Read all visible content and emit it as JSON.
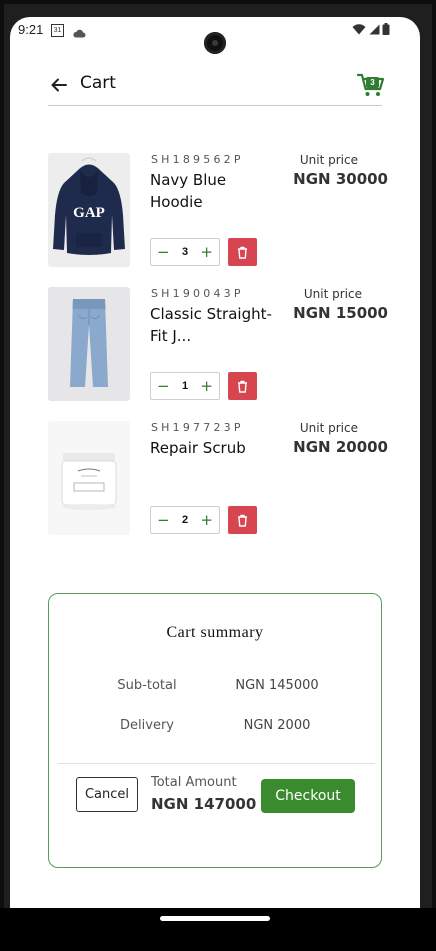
{
  "status_bar": {
    "time": "9:21",
    "calendar_day": "31"
  },
  "header": {
    "title": "Cart",
    "cart_count": "3"
  },
  "cart_items": [
    {
      "sku": "SH189562P",
      "name": "Navy Blue Hoodie",
      "unit_price_label": "Unit price",
      "unit_price": "NGN 30000",
      "quantity": "3",
      "image": "navy-hoodie-image"
    },
    {
      "sku": "SH190043P",
      "name": "Classic Straight-Fit J...",
      "unit_price_label": "Unit price",
      "unit_price": "NGN 15000",
      "quantity": "1",
      "image": "jeans-image"
    },
    {
      "sku": "SH197723P",
      "name": "Repair Scrub",
      "unit_price_label": "Unit price",
      "unit_price": "NGN 20000",
      "quantity": "2",
      "image": "scrub-jar-image"
    }
  ],
  "stepper": {
    "minus": "−",
    "plus": "+"
  },
  "summary": {
    "title": "Cart summary",
    "subtotal_label": "Sub-total",
    "subtotal_value": "NGN 145000",
    "delivery_label": "Delivery",
    "delivery_value": "NGN 2000",
    "total_label": "Total Amount",
    "total_value": "NGN 147000",
    "cancel_label": "Cancel",
    "checkout_label": "Checkout"
  },
  "colors": {
    "accent_green": "#3a8a2e",
    "delete_red": "#d64550"
  }
}
